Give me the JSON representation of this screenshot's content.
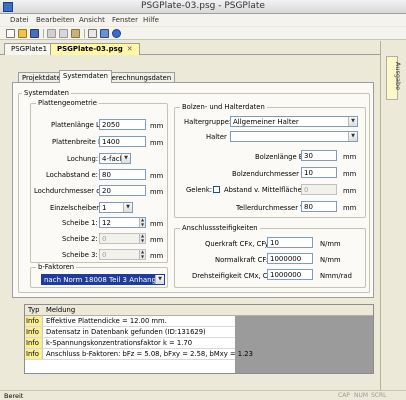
{
  "window": {
    "title": "PSGPlate-03.psg - PSGPlate"
  },
  "menu": [
    "Datei",
    "Bearbeiten",
    "Ansicht",
    "Fenster",
    "Hilfe"
  ],
  "doc_tabs": [
    {
      "label": "PSGPlate1",
      "active": false
    },
    {
      "label": "PSGPlate-03.psg",
      "active": true
    }
  ],
  "right_panel": {
    "label": "Ausgabe"
  },
  "inner_tabs": [
    {
      "label": "Projektdaten",
      "active": false
    },
    {
      "label": "Systemdaten",
      "active": true
    },
    {
      "label": "Berechnungsdaten",
      "active": false
    }
  ],
  "systemdaten": {
    "group_title": "Systemdaten",
    "plattengeometrie": {
      "title": "Plattengeometrie",
      "plattenlaenge": {
        "label": "Plattenlänge L:",
        "value": "2050",
        "unit": "mm"
      },
      "plattenbreite": {
        "label": "Plattenbreite B:",
        "value": "1400",
        "unit": "mm"
      },
      "lochung": {
        "label": "Lochung:",
        "value": "4-fach"
      },
      "lochabstand": {
        "label": "Lochabstand e:",
        "value": "80",
        "unit": "mm"
      },
      "lochdurchmesser": {
        "label": "Lochdurchmesser d:",
        "value": "20",
        "unit": "mm"
      },
      "einzelscheiben": {
        "label": "Einzelscheiben:",
        "value": "1"
      },
      "scheibe1": {
        "label": "Scheibe 1:",
        "value": "12",
        "unit": "mm"
      },
      "scheibe2": {
        "label": "Scheibe 2:",
        "value": "0",
        "unit": "mm"
      },
      "scheibe3": {
        "label": "Scheibe 3:",
        "value": "0",
        "unit": "mm"
      }
    },
    "b_faktoren": {
      "title": "b-Faktoren",
      "value": "nach Norm 18008 Teil 3 Anhang C"
    },
    "bolzen": {
      "title": "Bolzen- und Halterdaten",
      "haltergruppe": {
        "label": "Haltergruppe:",
        "value": "Allgemeiner Halter"
      },
      "halter": {
        "label": "Halter",
        "value": ""
      },
      "bolzenlaenge": {
        "label": "Bolzenlänge Bl:",
        "value": "30",
        "unit": "mm"
      },
      "bolzendurchmesser": {
        "label": "Bolzendurchmesser Bd:",
        "value": "10",
        "unit": "mm"
      },
      "gelenk": {
        "label": "Gelenk:",
        "checkbox_label": "Abstand v. Mittelfläche g:",
        "value": "0",
        "unit": "mm"
      },
      "tellerdurchmesser": {
        "label": "Tellerdurchmesser Td:",
        "value": "80",
        "unit": "mm"
      }
    },
    "anschluss": {
      "title": "Anschlusssteifigkeiten",
      "querkraft": {
        "label": "Querkraft CFx, CFy:",
        "value": "10",
        "unit": "N/mm"
      },
      "normalkraft": {
        "label": "Normalkraft CFz:",
        "value": "1000000",
        "unit": "N/mm"
      },
      "drehsteifigkeit": {
        "label": "Drehsteifigkeit CMx, CMy:",
        "value": "1000000",
        "unit": "Nmm/rad"
      }
    }
  },
  "messages": {
    "headers": [
      "Typ",
      "Meldung"
    ],
    "rows": [
      {
        "type": "Info",
        "text": "Effektive Plattendicke = 12.00 mm."
      },
      {
        "type": "Info",
        "text": "Datensatz in Datenbank gefunden (ID:131629)"
      },
      {
        "type": "Info",
        "text": "k-Spannungskonzentrationsfaktor k = 1.70"
      },
      {
        "type": "Info",
        "text": "Anschluss b-Faktoren: bFz = 5.08, bFxy = 2.58, bMxy = 1.23"
      }
    ]
  },
  "status": {
    "ready": "Bereit",
    "indicators": [
      "CAP",
      "NUM",
      "SCRL"
    ]
  }
}
